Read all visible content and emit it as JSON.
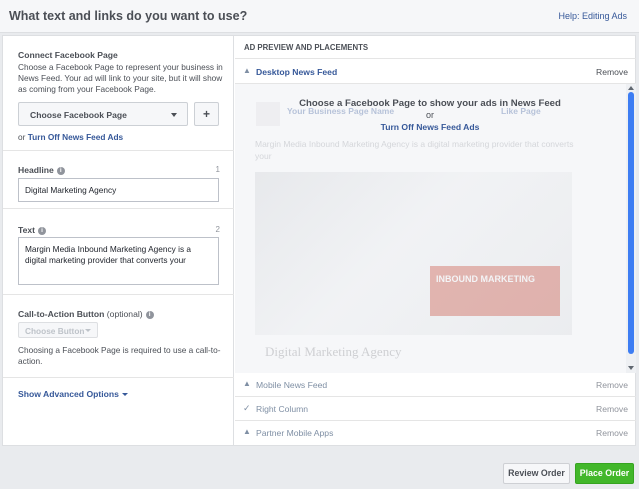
{
  "header": {
    "title": "What text and links do you want to use?",
    "help_link": "Help: Editing Ads"
  },
  "connect_page": {
    "label": "Connect Facebook Page",
    "help": "Choose a Facebook Page to represent your business in News Feed. Your ad will link to your site, but it will show as coming from your Facebook Page.",
    "select_label": "Choose Facebook Page",
    "plus_label": "+",
    "or_text": "or",
    "turn_off_link": "Turn Off News Feed Ads"
  },
  "headline": {
    "label": "Headline",
    "count": "1",
    "value": "Digital Marketing Agency"
  },
  "text": {
    "label": "Text",
    "count": "2",
    "value": "Margin Media Inbound Marketing Agency is a digital marketing provider that converts your"
  },
  "cta": {
    "label": "Call-to-Action Button",
    "optional": "(optional)",
    "button_label": "Choose Button",
    "help": "Choosing a Facebook Page is required to use a call-to-action."
  },
  "advanced": {
    "label": "Show Advanced Options"
  },
  "preview": {
    "heading": "AD PREVIEW AND PLACEMENTS",
    "message_line1": "Choose a Facebook Page to show your ads in News Feed",
    "message_or": "or",
    "message_link": "Turn Off News Feed Ads",
    "ghost_page_name": "Your Business Page Name",
    "ghost_like": "Like Page",
    "ghost_body": "Margin Media Inbound Marketing Agency is a digital marketing provider that converts your",
    "ghost_banner": "INBOUND MARKETING",
    "ghost_headline": "Digital Marketing Agency",
    "placements": [
      {
        "name": "Desktop News Feed",
        "remove": "Remove",
        "icon": "triangle-up-icon"
      },
      {
        "name": "Mobile News Feed",
        "remove": "Remove",
        "icon": "triangle-up-icon"
      },
      {
        "name": "Right Column",
        "remove": "Remove",
        "icon": "check-icon"
      },
      {
        "name": "Partner Mobile Apps",
        "remove": "Remove",
        "icon": "triangle-up-icon"
      }
    ]
  },
  "footer": {
    "review_label": "Review Order",
    "place_label": "Place Order"
  },
  "colors": {
    "link": "#365899",
    "accent_green": "#42b72a",
    "scroll_thumb": "#3d7df3"
  }
}
